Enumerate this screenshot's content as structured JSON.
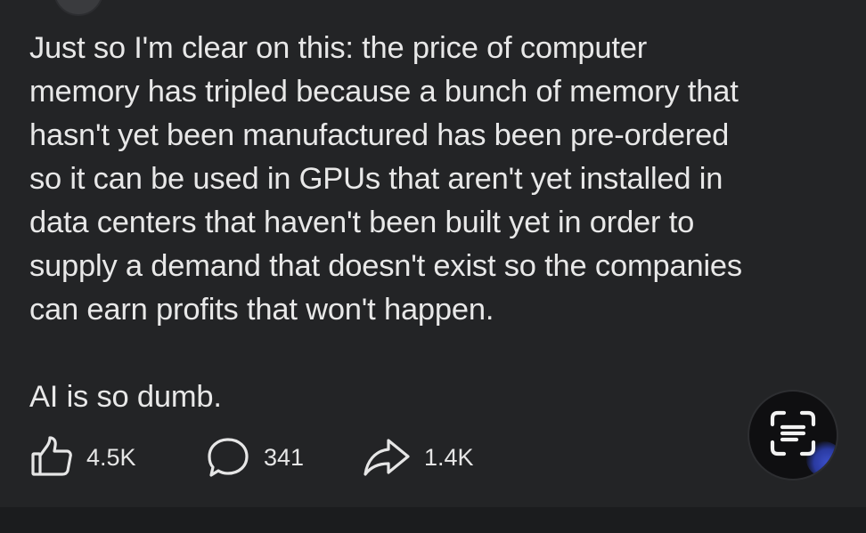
{
  "post": {
    "paragraph1": "Just so I'm clear on this:  the price of computer\nmemory has tripled because a bunch of memory that\nhasn't yet been manufactured has been pre-ordered\nso it can be used in GPUs that aren't yet installed in\ndata centers that haven't been built yet in order to\nsupply a demand that doesn't exist so the companies\ncan earn profits that won't happen.",
    "paragraph2": "AI is so dumb."
  },
  "actions": {
    "like_icon": "thumbs-up-outline",
    "likes": "4.5K",
    "comment_icon": "speech-bubble-outline",
    "comments": "341",
    "share_icon": "share-arrow-outline",
    "shares": "1.4K"
  },
  "scan_button": {
    "icon": "text-scan-icon"
  },
  "colors": {
    "background": "#232426",
    "text": "#e8e8e8",
    "accent_glow": "#3b4fc9"
  }
}
